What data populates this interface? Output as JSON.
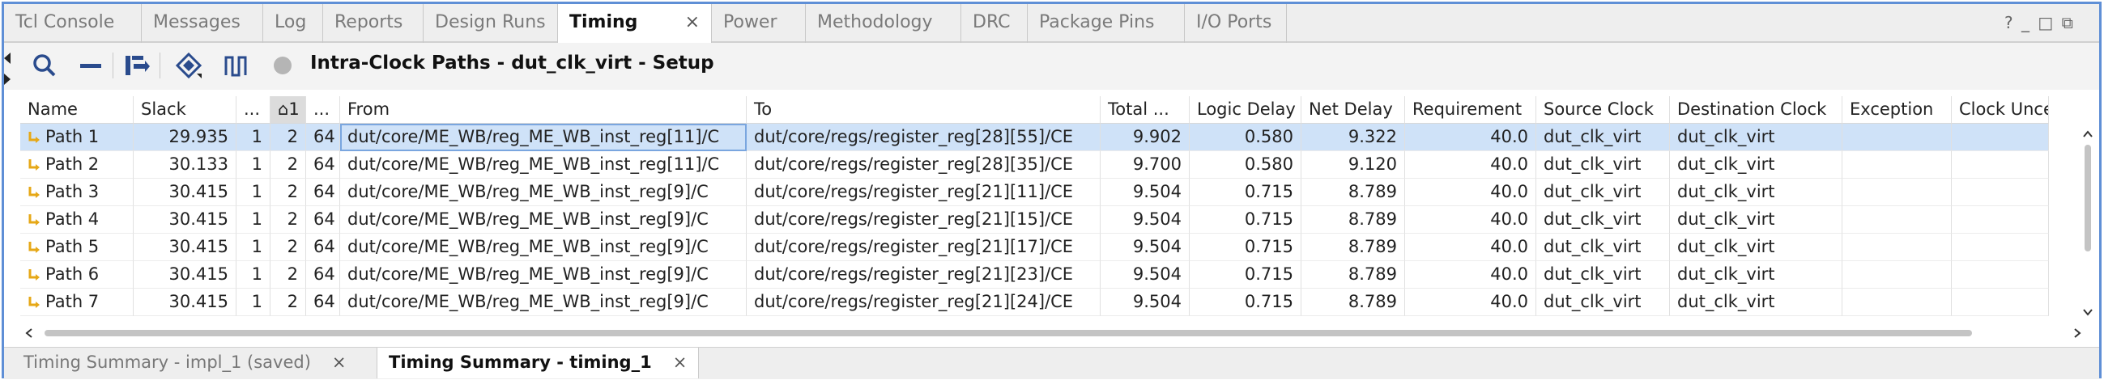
{
  "tabs": [
    {
      "label": "Tcl Console",
      "active": false
    },
    {
      "label": "Messages",
      "active": false
    },
    {
      "label": "Log",
      "active": false
    },
    {
      "label": "Reports",
      "active": false
    },
    {
      "label": "Design Runs",
      "active": false
    },
    {
      "label": "Timing",
      "active": true
    },
    {
      "label": "Power",
      "active": false
    },
    {
      "label": "Methodology",
      "active": false
    },
    {
      "label": "DRC",
      "active": false
    },
    {
      "label": "Package Pins",
      "active": false
    },
    {
      "label": "I/O Ports",
      "active": false
    }
  ],
  "window_controls": "? _ □ ⧉",
  "toolbar": {
    "title": "Intra-Clock Paths - dut_clk_virt - Setup",
    "icons": [
      "search-icon",
      "collapse-icon",
      "export-icon",
      "highlight-icon",
      "waveform-icon",
      "status-circle-icon"
    ]
  },
  "columns": [
    "Name",
    "Slack",
    "...",
    "⌂1",
    "...",
    "From",
    "To",
    "Total ...",
    "Logic Delay",
    "Net Delay",
    "Requirement",
    "Source Clock",
    "Destination Clock",
    "Exception",
    "Clock Unce"
  ],
  "rows": [
    [
      "Path 1",
      "29.935",
      "1",
      "2",
      "64",
      "dut/core/ME_WB/reg_ME_WB_inst_reg[11]/C",
      "dut/core/regs/register_reg[28][55]/CE",
      "9.902",
      "0.580",
      "9.322",
      "40.0",
      "dut_clk_virt",
      "dut_clk_virt",
      "",
      ""
    ],
    [
      "Path 2",
      "30.133",
      "1",
      "2",
      "64",
      "dut/core/ME_WB/reg_ME_WB_inst_reg[11]/C",
      "dut/core/regs/register_reg[28][35]/CE",
      "9.700",
      "0.580",
      "9.120",
      "40.0",
      "dut_clk_virt",
      "dut_clk_virt",
      "",
      ""
    ],
    [
      "Path 3",
      "30.415",
      "1",
      "2",
      "64",
      "dut/core/ME_WB/reg_ME_WB_inst_reg[9]/C",
      "dut/core/regs/register_reg[21][11]/CE",
      "9.504",
      "0.715",
      "8.789",
      "40.0",
      "dut_clk_virt",
      "dut_clk_virt",
      "",
      ""
    ],
    [
      "Path 4",
      "30.415",
      "1",
      "2",
      "64",
      "dut/core/ME_WB/reg_ME_WB_inst_reg[9]/C",
      "dut/core/regs/register_reg[21][15]/CE",
      "9.504",
      "0.715",
      "8.789",
      "40.0",
      "dut_clk_virt",
      "dut_clk_virt",
      "",
      ""
    ],
    [
      "Path 5",
      "30.415",
      "1",
      "2",
      "64",
      "dut/core/ME_WB/reg_ME_WB_inst_reg[9]/C",
      "dut/core/regs/register_reg[21][17]/CE",
      "9.504",
      "0.715",
      "8.789",
      "40.0",
      "dut_clk_virt",
      "dut_clk_virt",
      "",
      ""
    ],
    [
      "Path 6",
      "30.415",
      "1",
      "2",
      "64",
      "dut/core/ME_WB/reg_ME_WB_inst_reg[9]/C",
      "dut/core/regs/register_reg[21][23]/CE",
      "9.504",
      "0.715",
      "8.789",
      "40.0",
      "dut_clk_virt",
      "dut_clk_virt",
      "",
      ""
    ],
    [
      "Path 7",
      "30.415",
      "1",
      "2",
      "64",
      "dut/core/ME_WB/reg_ME_WB_inst_reg[9]/C",
      "dut/core/regs/register_reg[21][24]/CE",
      "9.504",
      "0.715",
      "8.789",
      "40.0",
      "dut_clk_virt",
      "dut_clk_virt",
      "",
      ""
    ]
  ],
  "selected_row": 0,
  "bottom_tabs": [
    {
      "label": "Timing Summary - impl_1 (saved)",
      "active": false
    },
    {
      "label": "Timing Summary - timing_1",
      "active": true
    }
  ],
  "colors": {
    "accent": "#5f8fd6",
    "selection": "#cfe2f8",
    "path_icon": "#e6a817"
  }
}
